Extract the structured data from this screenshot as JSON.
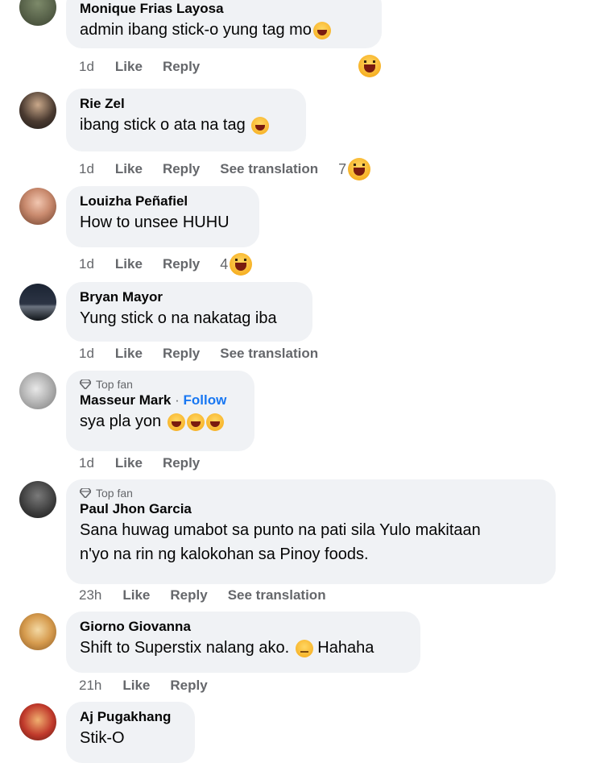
{
  "actions": {
    "like": "Like",
    "reply": "Reply",
    "see_translation": "See translation",
    "follow": "Follow",
    "top_fan": "Top fan"
  },
  "comments": [
    {
      "author": "Monique Frias Layosa",
      "text": "admin ibang stick-o yung tag mo",
      "time": "1d",
      "reaction_count": ""
    },
    {
      "author": "Rie Zel",
      "text": "ibang stick o ata na tag",
      "time": "1d",
      "reaction_count": "7"
    },
    {
      "author": "Louizha Peñafiel",
      "text": "How to unsee HUHU",
      "time": "1d",
      "reaction_count": "4"
    },
    {
      "author": "Bryan Mayor",
      "text": "Yung stick o na nakatag iba",
      "time": "1d",
      "reaction_count": ""
    },
    {
      "author": "Masseur Mark",
      "text": "sya pla yon",
      "time": "1d",
      "reaction_count": ""
    },
    {
      "author": "Paul Jhon Garcia",
      "text_line1": "Sana huwag umabot sa punto na pati sila Yulo makitaan",
      "text_line2": "n'yo na rin ng kalokohan sa Pinoy foods.",
      "time": "23h",
      "reaction_count": ""
    },
    {
      "author": "Giorno Giovanna",
      "text": "Shift to Superstix nalang ako.",
      "text_after": "Hahaha",
      "time": "21h",
      "reaction_count": ""
    },
    {
      "author": "Aj Pugakhang",
      "text": "Stik-O",
      "time": "",
      "reaction_count": ""
    }
  ]
}
